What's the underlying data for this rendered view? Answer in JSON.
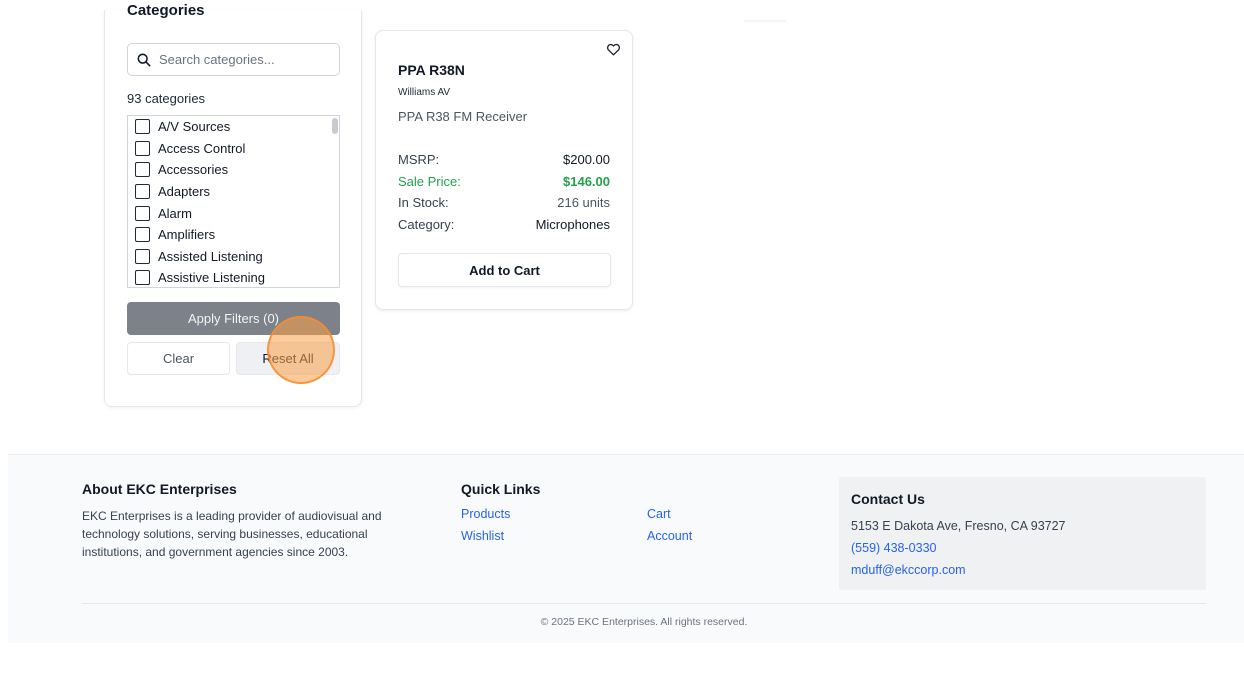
{
  "sidebar": {
    "title": "Categories",
    "search_placeholder": "Search categories...",
    "count": "93 categories",
    "items": [
      {
        "label": "A/V Sources"
      },
      {
        "label": "Access Control"
      },
      {
        "label": "Accessories"
      },
      {
        "label": "Adapters"
      },
      {
        "label": "Alarm"
      },
      {
        "label": "Amplifiers"
      },
      {
        "label": "Assisted Listening"
      },
      {
        "label": "Assistive Listening"
      }
    ],
    "apply_label": "Apply Filters (0)",
    "clear_label": "Clear",
    "reset_label": "Reset All"
  },
  "product": {
    "name": "PPA R38N",
    "brand": "Williams AV",
    "description": "PPA R38 FM Receiver",
    "msrp_label": "MSRP:",
    "msrp_value": "$200.00",
    "sale_label": "Sale Price:",
    "sale_value": "$146.00",
    "stock_label": "In Stock:",
    "stock_value": "216 units",
    "category_label": "Category:",
    "category_value": "Microphones",
    "add_to_cart_label": "Add to Cart"
  },
  "footer": {
    "about_title": "About EKC Enterprises",
    "about_text": "EKC Enterprises is a leading provider of audiovisual and technology solutions, serving businesses, educational institutions, and government agencies since 2003.",
    "links_title": "Quick Links",
    "links": {
      "products": "Products",
      "wishlist": "Wishlist",
      "cart": "Cart",
      "account": "Account"
    },
    "contact_title": "Contact Us",
    "address": "5153 E Dakota Ave, Fresno, CA 93727",
    "phone": "(559) 438-0330",
    "email": "mduff@ekccorp.com",
    "copyright": "© 2025 EKC Enterprises. All rights reserved."
  },
  "colors": {
    "sale_green": "#22a04b",
    "link_blue": "#2563eb",
    "apply_gray": "#7d8189",
    "click_marker": "#fba046"
  },
  "icons": {
    "search": "search-icon",
    "wishlist": "heart-icon",
    "checkbox": "checkbox-icon"
  }
}
